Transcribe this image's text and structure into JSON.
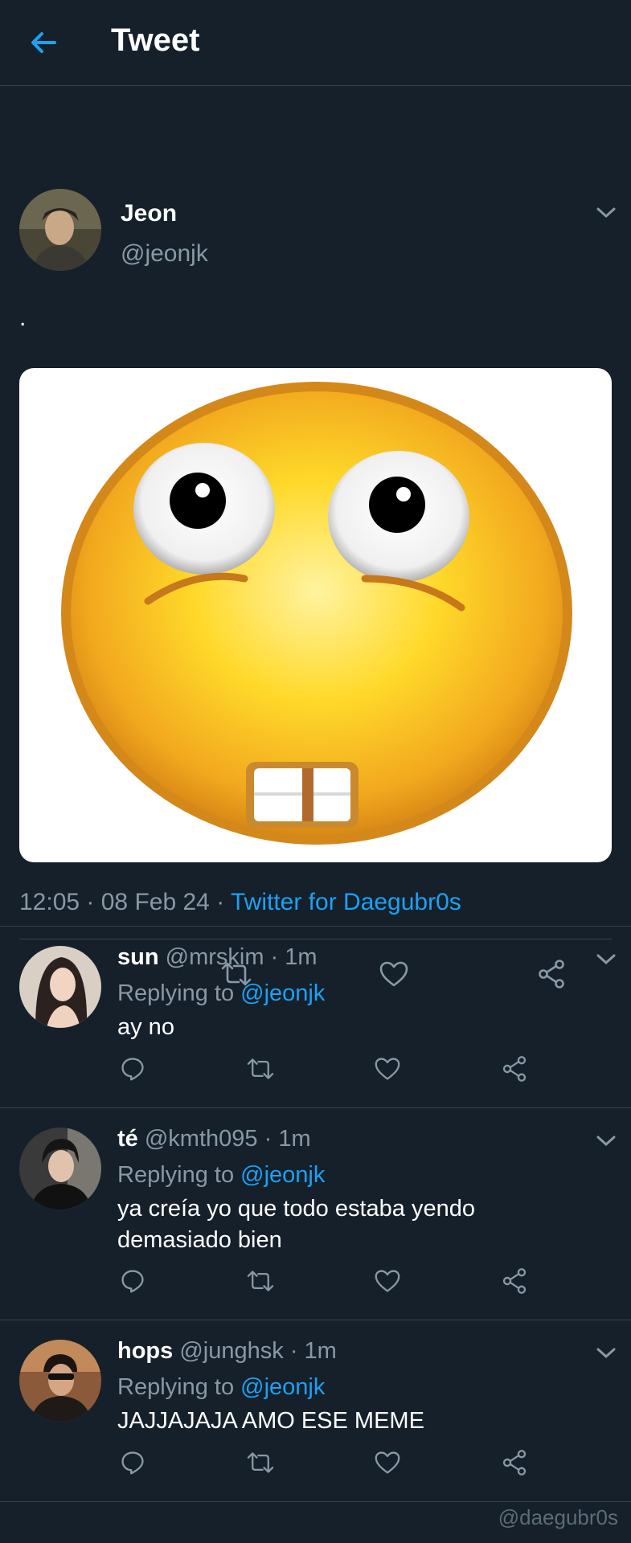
{
  "header": {
    "title": "Tweet",
    "back_icon": "arrow-left-icon"
  },
  "tweet": {
    "author_name": "Jeon",
    "author_handle": "@jeonjk",
    "text": ".",
    "time": "12:05",
    "date": "08 Feb 24",
    "source": "Twitter for Daegubr0s",
    "media_description_icon": "nervous-emoji-image"
  },
  "replies": [
    {
      "name": "sun",
      "handle": "@mrskim",
      "time": "1m",
      "replying_label": "Replying to",
      "replying_to": "@jeonjk",
      "text": "ay no"
    },
    {
      "name": "té",
      "handle": "@kmth095",
      "time": "1m",
      "replying_label": "Replying to",
      "replying_to": "@jeonjk",
      "text": "ya creía yo que todo estaba yendo demasiado bien"
    },
    {
      "name": "hops",
      "handle": "@junghsk",
      "time": "1m",
      "replying_label": "Replying to",
      "replying_to": "@jeonjk",
      "text": "JAJJAJAJA AMO ESE MEME"
    }
  ],
  "watermark": "@daegubr0s",
  "colors": {
    "background": "#15202b",
    "accent": "#1da1f2",
    "muted": "#8899a6",
    "divider": "#38444d"
  }
}
